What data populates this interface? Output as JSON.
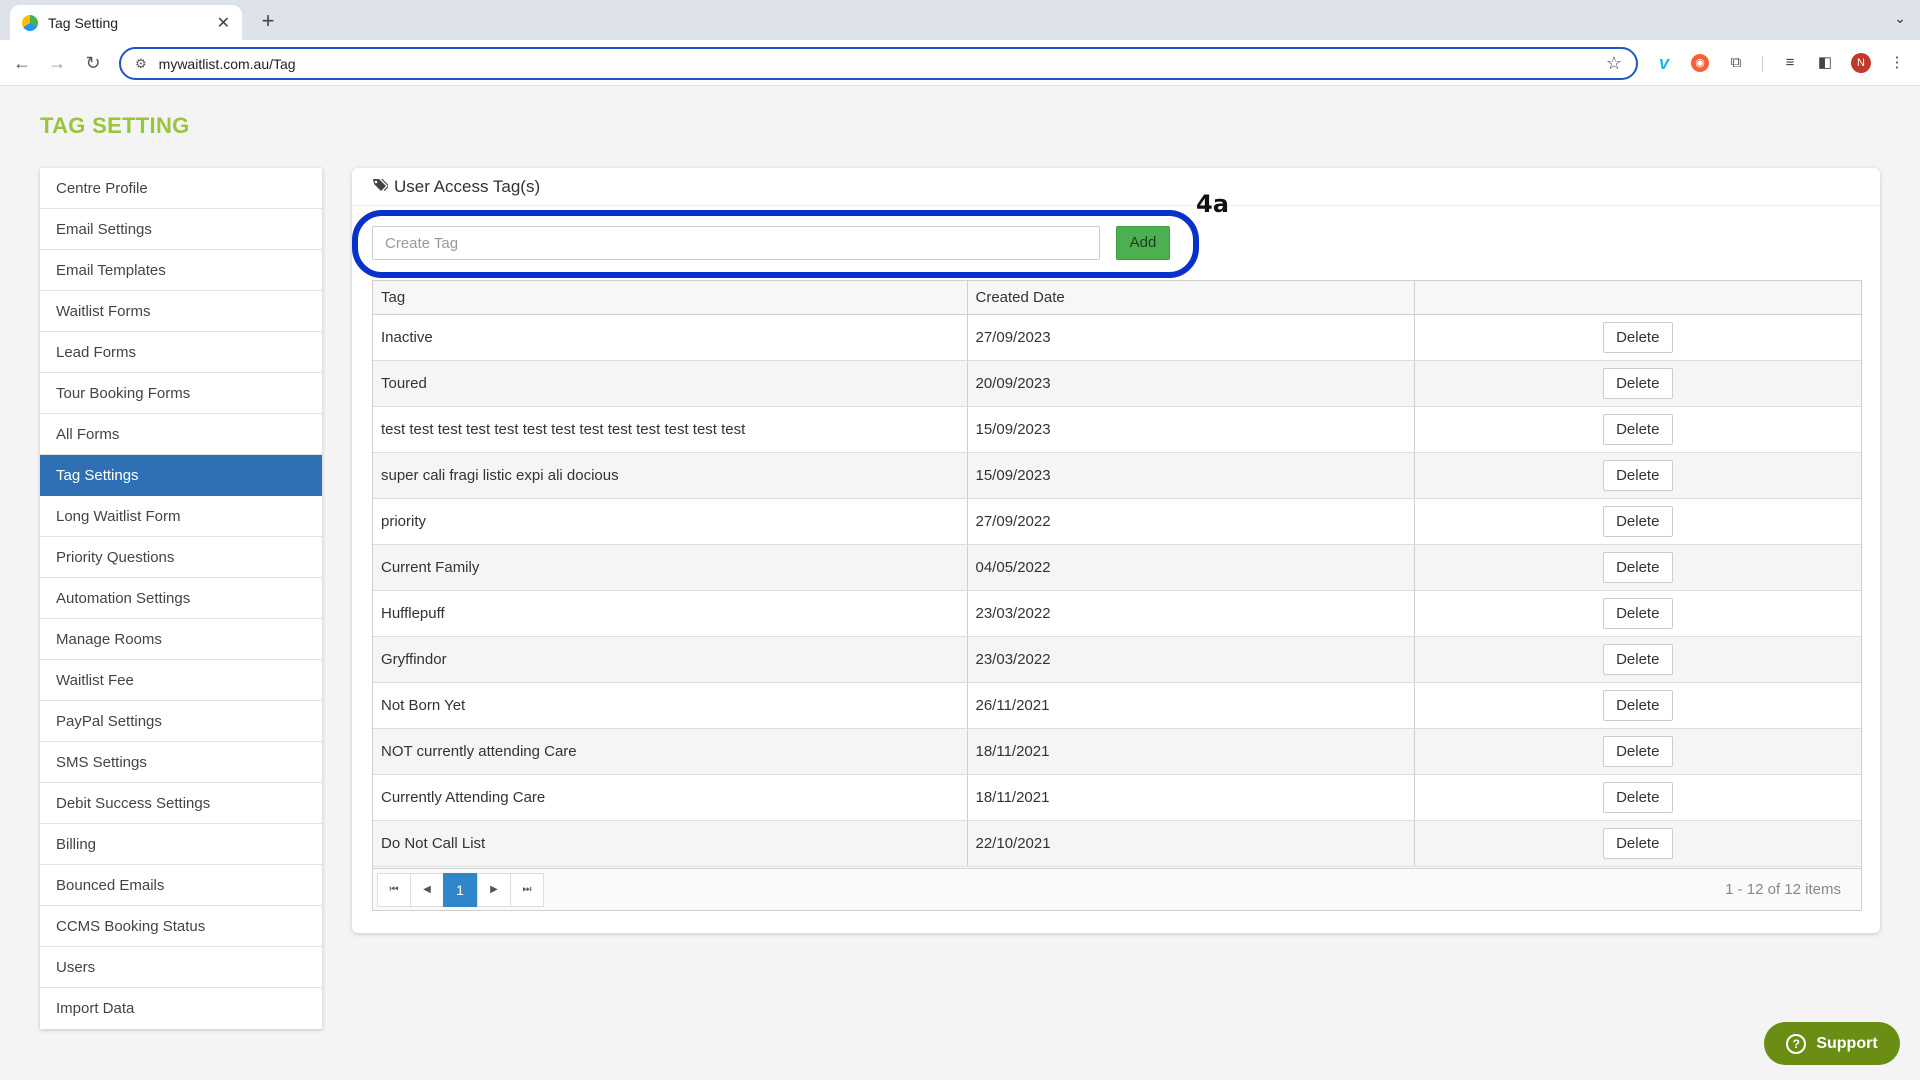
{
  "browser": {
    "tab_title": "Tag Setting",
    "tab_close": "✕",
    "new_tab": "+",
    "tab_menu": "⌄",
    "url": "mywaitlist.com.au/Tag",
    "avatar_letter": "N"
  },
  "page": {
    "title": "TAG SETTING"
  },
  "sidebar": {
    "items": [
      {
        "label": "Centre Profile",
        "active": false
      },
      {
        "label": "Email Settings",
        "active": false
      },
      {
        "label": "Email Templates",
        "active": false
      },
      {
        "label": "Waitlist Forms",
        "active": false
      },
      {
        "label": "Lead Forms",
        "active": false
      },
      {
        "label": "Tour Booking Forms",
        "active": false
      },
      {
        "label": "All Forms",
        "active": false
      },
      {
        "label": "Tag Settings",
        "active": true
      },
      {
        "label": "Long Waitlist Form",
        "active": false
      },
      {
        "label": "Priority Questions",
        "active": false
      },
      {
        "label": "Automation Settings",
        "active": false
      },
      {
        "label": "Manage Rooms",
        "active": false
      },
      {
        "label": "Waitlist Fee",
        "active": false
      },
      {
        "label": "PayPal Settings",
        "active": false
      },
      {
        "label": "SMS Settings",
        "active": false
      },
      {
        "label": "Debit Success Settings",
        "active": false
      },
      {
        "label": "Billing",
        "active": false
      },
      {
        "label": "Bounced Emails",
        "active": false
      },
      {
        "label": "CCMS Booking Status",
        "active": false
      },
      {
        "label": "Users",
        "active": false
      },
      {
        "label": "Import Data",
        "active": false
      }
    ]
  },
  "card": {
    "title": "User Access Tag(s)",
    "create_placeholder": "Create Tag",
    "add_label": "Add",
    "annotation": "4a"
  },
  "table": {
    "headers": [
      "Tag",
      "Created Date",
      ""
    ],
    "delete_label": "Delete",
    "rows": [
      {
        "tag": "Inactive",
        "date": "27/09/2023"
      },
      {
        "tag": "Toured",
        "date": "20/09/2023"
      },
      {
        "tag": "test test test test test test test test test test test test test",
        "date": "15/09/2023"
      },
      {
        "tag": "super cali fragi listic expi ali docious",
        "date": "15/09/2023"
      },
      {
        "tag": "priority",
        "date": "27/09/2022"
      },
      {
        "tag": "Current Family",
        "date": "04/05/2022"
      },
      {
        "tag": "Hufflepuff",
        "date": "23/03/2022"
      },
      {
        "tag": "Gryffindor",
        "date": "23/03/2022"
      },
      {
        "tag": "Not Born Yet",
        "date": "26/11/2021"
      },
      {
        "tag": "NOT currently attending Care",
        "date": "18/11/2021"
      },
      {
        "tag": "Currently Attending Care",
        "date": "18/11/2021"
      },
      {
        "tag": "Do Not Call List",
        "date": "22/10/2021"
      }
    ]
  },
  "pager": {
    "current_page": "1",
    "info": "1 - 12 of 12 items"
  },
  "support": {
    "label": "Support"
  },
  "colors": {
    "title_green": "#9ac43c",
    "active_blue": "#2f6fb3",
    "add_green": "#4caf50",
    "highlight_blue": "#0a31c9",
    "support_green": "#6a8e14"
  }
}
